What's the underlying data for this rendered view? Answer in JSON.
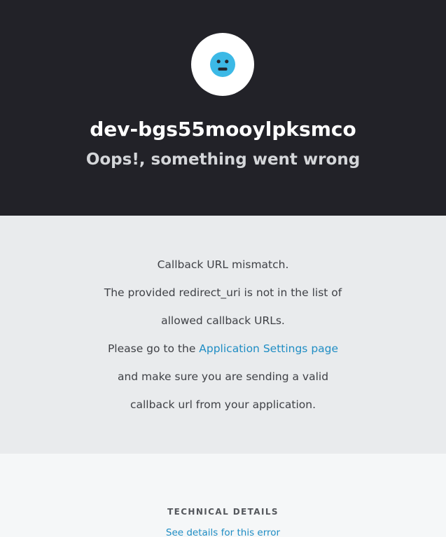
{
  "header": {
    "avatar_icon": "sad-face-icon",
    "tenant_name": "dev-bgs55mooylpksmco",
    "subtitle": "Oops!, something went wrong"
  },
  "message": {
    "line1": "Callback URL mismatch.",
    "line2": "The provided redirect_uri is not in the list of",
    "line3": "allowed callback URLs.",
    "line4_prefix": "Please go to the ",
    "line4_link": "Application Settings page",
    "line5": "and make sure you are sending a valid",
    "line6": "callback url from your application."
  },
  "technical": {
    "title": "TECHNICAL DETAILS",
    "details_link": "See details for this error"
  },
  "colors": {
    "hero_bg": "#222228",
    "message_bg": "#e9ebed",
    "footer_bg": "#f5f7f8",
    "link": "#1f8dc4",
    "icon": "#3cb9e6"
  }
}
